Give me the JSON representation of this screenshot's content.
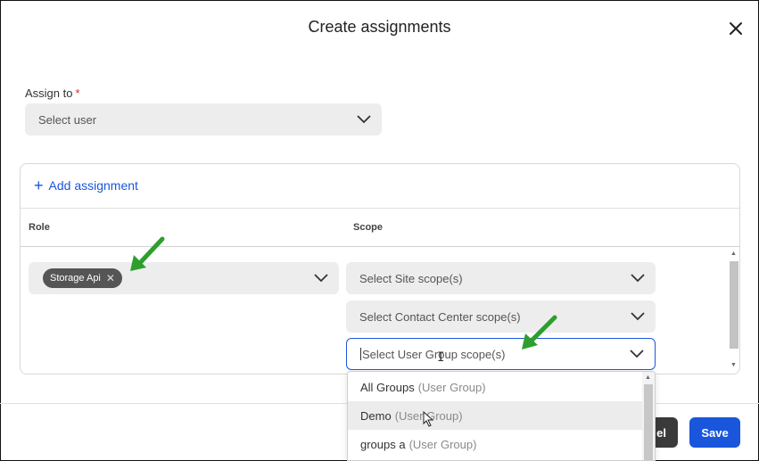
{
  "dialog": {
    "title": "Create assignments"
  },
  "assign_to": {
    "label": "Assign to",
    "required_mark": "*",
    "placeholder": "Select user"
  },
  "assignment": {
    "add_label": "Add assignment",
    "columns": {
      "role": "Role",
      "scope": "Scope"
    },
    "role_chip": "Storage Api",
    "scope_selects": {
      "site": "Select Site scope(s)",
      "contact_center": "Select Contact Center scope(s)",
      "user_group": "Select User Group scope(s)"
    }
  },
  "dropdown": {
    "options": [
      {
        "name": "All Groups",
        "type": "(User Group)"
      },
      {
        "name": "Demo",
        "type": "(User Group)"
      },
      {
        "name": "groups a",
        "type": "(User Group)"
      }
    ]
  },
  "footer": {
    "cancel_partial": "el",
    "save": "Save"
  },
  "colors": {
    "accent": "#1a56db",
    "annotation_arrow": "#2e9e2e"
  }
}
